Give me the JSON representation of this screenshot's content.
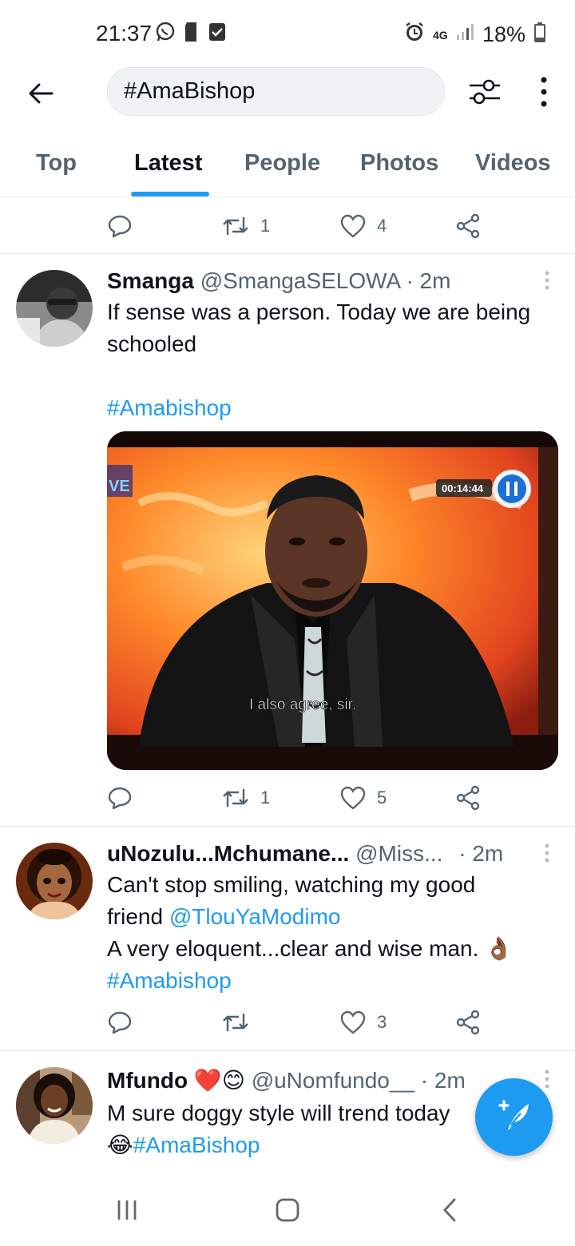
{
  "status_bar": {
    "time": "21:37",
    "network": "4G",
    "battery": "18%"
  },
  "header": {
    "search_value": "#AmaBishop",
    "icons": [
      "back-arrow-icon",
      "filter-sliders-icon",
      "more-vertical-icon"
    ]
  },
  "tabs": [
    {
      "label": "Top",
      "active": false
    },
    {
      "label": "Latest",
      "active": true
    },
    {
      "label": "People",
      "active": false
    },
    {
      "label": "Photos",
      "active": false
    },
    {
      "label": "Videos",
      "active": false
    }
  ],
  "top_actions": {
    "retweets": "1",
    "likes": "4"
  },
  "tweets": [
    {
      "name": "Smanga",
      "handle": "@SmangaSELOWA",
      "time": "· 2m",
      "text_line1": "If sense was a person. Today we are being",
      "text_line2": "schooled",
      "hashtag": "#Amabishop",
      "media": {
        "timecode": "00:14:44",
        "caption": "I also agree, sir.",
        "channel_logo": "VE"
      },
      "retweets": "1",
      "likes": "5"
    },
    {
      "name": "uNozulu...Mchumane...",
      "handle": "@Miss...",
      "time": "· 2m",
      "text_line1": "Can't stop smiling, watching my good",
      "text_line2_prefix": "friend ",
      "mention": "@TlouYaModimo",
      "text_line3": "A very eloquent...clear and wise man. 👌🏾",
      "hashtag": "#Amabishop",
      "retweets": "",
      "likes": "3"
    },
    {
      "name": "Mfundo ❤️😊",
      "handle": "@uNomfundo__",
      "time": "· 2m",
      "text_line1": "M sure doggy style will trend today",
      "emoji": "😂",
      "hashtag": "#AmaBishop"
    }
  ],
  "colors": {
    "accent": "#1d9bf0",
    "text_primary": "#0f1419",
    "text_secondary": "#536471",
    "divider": "#e1e6e9"
  }
}
